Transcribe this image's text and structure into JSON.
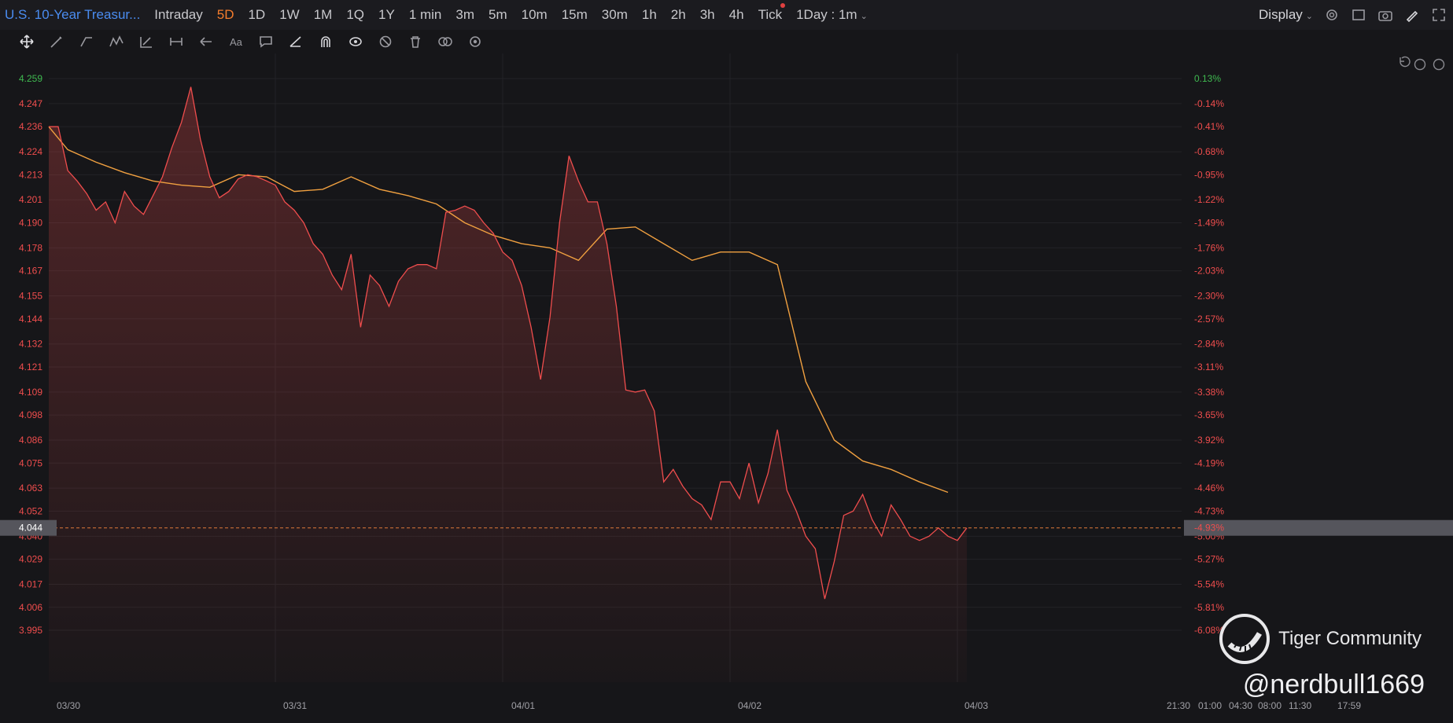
{
  "header": {
    "symbol": "U.S. 10-Year Treasur...",
    "timeframes": [
      "Intraday",
      "5D",
      "1D",
      "1W",
      "1M",
      "1Q",
      "1Y",
      "1 min",
      "3m",
      "5m",
      "10m",
      "15m",
      "30m",
      "1h",
      "2h",
      "3h",
      "4h",
      "Tick"
    ],
    "active_timeframe": "5D",
    "interval": "1Day : 1m",
    "display_label": "Display"
  },
  "colors": {
    "up": "#3fb950",
    "down": "#ef4d4d",
    "line": "#ef4d4d",
    "avg": "#f0a040",
    "accent": "#f47c2c",
    "link": "#4a8cf0"
  },
  "icons": [
    "move-icon",
    "pen-icon",
    "trend-icon",
    "pattern-icon",
    "fib-icon",
    "measure-icon",
    "arrow-icon",
    "text-icon",
    "comment-icon",
    "ruler-icon",
    "magnet-icon",
    "eye-icon",
    "hide-icon",
    "trash-icon",
    "compare-icon",
    "settings-icon"
  ],
  "chart_data": {
    "type": "line",
    "ylim": [
      3.985,
      4.265
    ],
    "y_ticks": [
      "4.259",
      "4.247",
      "4.236",
      "4.224",
      "4.213",
      "4.201",
      "4.190",
      "4.178",
      "4.167",
      "4.155",
      "4.144",
      "4.132",
      "4.121",
      "4.109",
      "4.098",
      "4.086",
      "4.075",
      "4.063",
      "4.052",
      "4.040",
      "4.029",
      "4.017",
      "4.006",
      "3.995"
    ],
    "pct_ticks": [
      "0.13%",
      "-0.14%",
      "-0.41%",
      "-0.68%",
      "-0.95%",
      "-1.22%",
      "-1.49%",
      "-1.76%",
      "-2.03%",
      "-2.30%",
      "-2.57%",
      "-2.84%",
      "-3.11%",
      "-3.38%",
      "-3.65%",
      "-3.92%",
      "-4.19%",
      "-4.46%",
      "-4.73%",
      "-5.00%",
      "-5.27%",
      "-5.54%",
      "-5.81%",
      "-6.08%"
    ],
    "x_labels": [
      "03/30",
      "03/31",
      "04/01",
      "04/02",
      "04/03",
      "21:30",
      "01:00",
      "04:30",
      "08:00",
      "11:30",
      "17:59"
    ],
    "current_value": "4.044",
    "current_pct": "-4.93%",
    "price_series": {
      "x": [
        "03/30 00:00",
        "03/30 01:00",
        "03/30 02:00",
        "03/30 03:00",
        "03/30 04:00",
        "03/30 05:00",
        "03/30 06:00",
        "03/30 07:00",
        "03/30 08:00",
        "03/30 09:00",
        "03/30 10:00",
        "03/30 11:00",
        "03/30 12:00",
        "03/30 13:00",
        "03/30 14:00",
        "03/30 15:00",
        "03/30 16:00",
        "03/30 17:00",
        "03/30 18:00",
        "03/30 19:00",
        "03/30 20:00",
        "03/30 21:00",
        "03/30 22:00",
        "03/30 23:00",
        "03/31 00:00",
        "03/31 01:00",
        "03/31 02:00",
        "03/31 03:00",
        "03/31 04:00",
        "03/31 05:00",
        "03/31 06:00",
        "03/31 07:00",
        "03/31 08:00",
        "03/31 09:00",
        "03/31 10:00",
        "03/31 11:00",
        "03/31 12:00",
        "03/31 13:00",
        "03/31 14:00",
        "03/31 15:00",
        "03/31 16:00",
        "03/31 17:00",
        "03/31 18:00",
        "03/31 19:00",
        "03/31 20:00",
        "03/31 21:00",
        "03/31 22:00",
        "03/31 23:00",
        "04/01 00:00",
        "04/01 01:00",
        "04/01 02:00",
        "04/01 03:00",
        "04/01 04:00",
        "04/01 05:00",
        "04/01 06:00",
        "04/01 07:00",
        "04/01 08:00",
        "04/01 09:00",
        "04/01 10:00",
        "04/01 11:00",
        "04/01 12:00",
        "04/01 13:00",
        "04/01 14:00",
        "04/01 15:00",
        "04/01 16:00",
        "04/01 17:00",
        "04/01 18:00",
        "04/01 19:00",
        "04/01 20:00",
        "04/01 21:00",
        "04/01 22:00",
        "04/01 23:00",
        "04/02 00:00",
        "04/02 01:00",
        "04/02 02:00",
        "04/02 03:00",
        "04/02 04:00",
        "04/02 05:00",
        "04/02 06:00",
        "04/02 07:00",
        "04/02 08:00",
        "04/02 09:00",
        "04/02 10:00",
        "04/02 11:00",
        "04/02 12:00",
        "04/02 13:00",
        "04/02 14:00",
        "04/02 15:00",
        "04/02 16:00",
        "04/02 17:00",
        "04/02 18:00",
        "04/02 19:00",
        "04/02 20:00",
        "04/02 21:00",
        "04/02 22:00",
        "04/02 23:00",
        "04/03 00:00",
        "04/03 01:00"
      ],
      "y": [
        4.236,
        4.236,
        4.215,
        4.21,
        4.204,
        4.196,
        4.2,
        4.19,
        4.205,
        4.198,
        4.194,
        4.203,
        4.212,
        4.226,
        4.238,
        4.255,
        4.23,
        4.212,
        4.202,
        4.205,
        4.211,
        4.213,
        4.212,
        4.21,
        4.208,
        4.2,
        4.196,
        4.19,
        4.18,
        4.175,
        4.165,
        4.158,
        4.175,
        4.14,
        4.165,
        4.16,
        4.15,
        4.162,
        4.168,
        4.17,
        4.17,
        4.168,
        4.195,
        4.196,
        4.198,
        4.196,
        4.19,
        4.185,
        4.176,
        4.172,
        4.16,
        4.14,
        4.115,
        4.145,
        4.19,
        4.222,
        4.21,
        4.2,
        4.2,
        4.18,
        4.15,
        4.11,
        4.109,
        4.11,
        4.1,
        4.066,
        4.072,
        4.064,
        4.058,
        4.055,
        4.048,
        4.066,
        4.066,
        4.058,
        4.075,
        4.056,
        4.07,
        4.091,
        4.062,
        4.052,
        4.04,
        4.034,
        4.01,
        4.028,
        4.05,
        4.052,
        4.06,
        4.048,
        4.04,
        4.055,
        4.048,
        4.04,
        4.038,
        4.04,
        4.044,
        4.04,
        4.038,
        4.044
      ]
    },
    "average_series": {
      "x": [
        "03/30 00:00",
        "03/30 02:00",
        "03/30 05:00",
        "03/30 08:00",
        "03/30 11:00",
        "03/30 14:00",
        "03/30 17:00",
        "03/30 20:00",
        "03/30 23:00",
        "03/31 02:00",
        "03/31 05:00",
        "03/31 08:00",
        "03/31 11:00",
        "03/31 14:00",
        "03/31 17:00",
        "03/31 20:00",
        "03/31 23:00",
        "04/01 02:00",
        "04/01 05:00",
        "04/01 08:00",
        "04/01 11:00",
        "04/01 14:00",
        "04/01 17:00",
        "04/01 20:00",
        "04/01 23:00",
        "04/02 02:00",
        "04/02 05:00",
        "04/02 08:00",
        "04/02 11:00",
        "04/02 14:00",
        "04/02 17:00",
        "04/02 20:00",
        "04/02 23:00"
      ],
      "y": [
        4.236,
        4.225,
        4.219,
        4.214,
        4.21,
        4.208,
        4.207,
        4.213,
        4.212,
        4.205,
        4.206,
        4.212,
        4.206,
        4.203,
        4.199,
        4.19,
        4.184,
        4.18,
        4.178,
        4.172,
        4.187,
        4.188,
        4.18,
        4.172,
        4.176,
        4.176,
        4.17,
        4.114,
        4.086,
        4.076,
        4.072,
        4.066,
        4.061
      ]
    }
  },
  "watermark": {
    "brand": "Tiger Community",
    "handle": "@nerdbull1669"
  }
}
